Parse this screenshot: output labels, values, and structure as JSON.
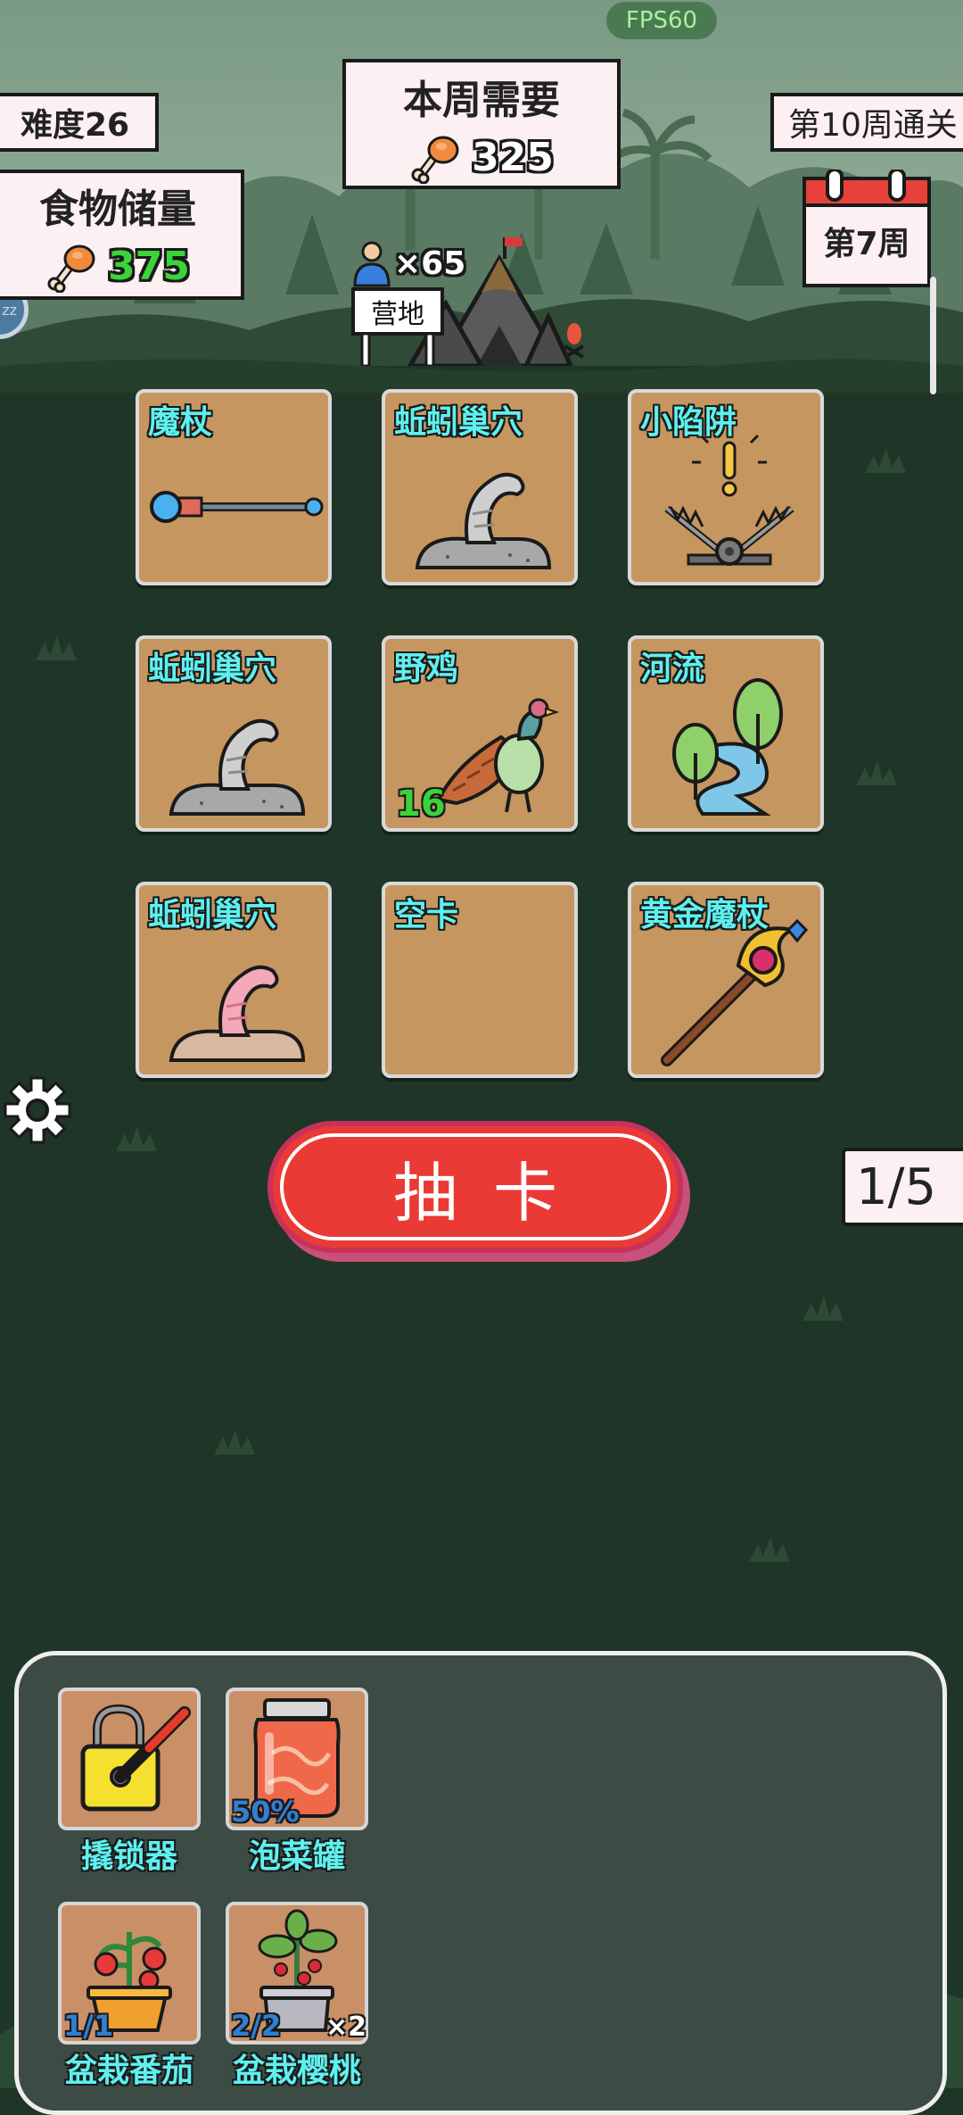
{
  "hud": {
    "fps": "FPS60",
    "difficulty": "难度26",
    "weekly_title": "本周需要",
    "weekly_amount": "325",
    "storage_title": "食物储量",
    "storage_amount": "375",
    "clear_goal": "第10周通关",
    "current_week": "第7周",
    "population": "×65",
    "camp_label": "营地"
  },
  "cards": [
    {
      "name": "魔杖",
      "icon": "magic-wand-icon"
    },
    {
      "name": "蚯蚓巢穴",
      "icon": "gray-worm-nest-icon"
    },
    {
      "name": "小陷阱",
      "icon": "bear-trap-icon"
    },
    {
      "name": "蚯蚓巢穴",
      "icon": "gray-worm-nest-icon"
    },
    {
      "name": "野鸡",
      "icon": "pheasant-icon",
      "count": "16"
    },
    {
      "name": "河流",
      "icon": "river-icon"
    },
    {
      "name": "蚯蚓巢穴",
      "icon": "pink-worm-nest-icon"
    },
    {
      "name": "空卡",
      "icon": ""
    },
    {
      "name": "黄金魔杖",
      "icon": "golden-wand-icon"
    }
  ],
  "draw": {
    "label": "抽卡",
    "counter": "1/5"
  },
  "inventory": [
    {
      "name": "撬锁器",
      "icon": "lockpick-icon",
      "stat": ""
    },
    {
      "name": "泡菜罐",
      "icon": "kimchi-jar-icon",
      "stat": "50%"
    },
    {
      "name": "盆栽番茄",
      "icon": "potted-tomato-icon",
      "stat": "1/1"
    },
    {
      "name": "盆栽樱桃",
      "icon": "potted-cherry-icon",
      "stat": "2/2",
      "multiplier": "×2"
    }
  ],
  "colors": {
    "background": "#1f3527",
    "card": "#c59660",
    "card_label": "#5ef0ef",
    "draw_button": "#ea3a36",
    "panel": "#fdf0f3"
  }
}
